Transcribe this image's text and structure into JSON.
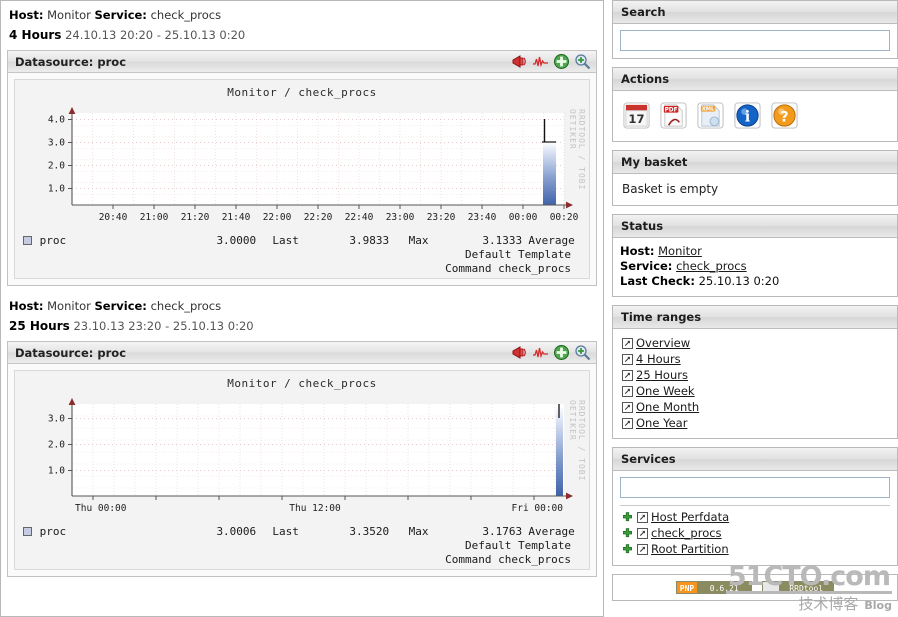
{
  "left": {
    "graphs": [
      {
        "host_label": "Host:",
        "host_value": "Monitor",
        "service_label": "Service:",
        "service_value": "check_procs",
        "range_label": "4 Hours",
        "range_value": "24.10.13 20:20 - 25.10.13 0:20",
        "panel_title": "Datasource: proc",
        "tools": [
          "alert-icon",
          "signal-icon",
          "add-icon",
          "zoom-in-icon"
        ],
        "graph_title": "Monitor / check_procs",
        "watermark": "RRDTOOL / TOBI OETIKER",
        "legend": {
          "swatch_name": "proc",
          "value": "3.0000",
          "value_label": "Last",
          "max": "3.9833",
          "max_label": "Max",
          "average": "3.1333",
          "average_label": "Average",
          "template": "Default Template",
          "command": "Command check_procs"
        },
        "chart_data": {
          "type": "area",
          "title": "Monitor / check_procs",
          "xlabel": "",
          "ylabel": "",
          "ylim": [
            0,
            4.3
          ],
          "yticks": [
            1.0,
            2.0,
            3.0,
            4.0
          ],
          "ytick_labels": [
            "1.0",
            "2.0",
            "3.0",
            "4.0"
          ],
          "xticks": [
            "20:40",
            "21:00",
            "21:20",
            "21:40",
            "22:00",
            "22:20",
            "22:40",
            "23:00",
            "23:20",
            "23:40",
            "00:00",
            "00:20"
          ],
          "grid": true,
          "series": [
            {
              "name": "proc",
              "color": "#4169b0",
              "x": [
                "20:20",
                "23:40",
                "23:58",
                "00:02",
                "00:06",
                "00:10",
                "00:14",
                "00:20"
              ],
              "values": [
                0,
                0,
                3.0,
                3.9833,
                3.0,
                3.0,
                3.0,
                3.0
              ]
            }
          ],
          "notes": "Flat zero until near right edge, then a filled blue column rising to ~3.0 with a thin spike to ~3.98"
        }
      },
      {
        "host_label": "Host:",
        "host_value": "Monitor",
        "service_label": "Service:",
        "service_value": "check_procs",
        "range_label": "25 Hours",
        "range_value": "23.10.13 23:20 - 25.10.13 0:20",
        "panel_title": "Datasource: proc",
        "tools": [
          "alert-icon",
          "signal-icon",
          "add-icon",
          "zoom-in-icon"
        ],
        "graph_title": "Monitor / check_procs",
        "watermark": "RRDTOOL / TOBI OETIKER",
        "legend": {
          "swatch_name": "proc",
          "value": "3.0006",
          "value_label": "Last",
          "max": "3.3520",
          "max_label": "Max",
          "average": "3.1763",
          "average_label": "Average",
          "template": "Default Template",
          "command": "Command check_procs"
        },
        "chart_data": {
          "type": "area",
          "title": "Monitor / check_procs",
          "xlabel": "",
          "ylabel": "",
          "ylim": [
            0,
            3.6
          ],
          "yticks": [
            1.0,
            2.0,
            3.0
          ],
          "ytick_labels": [
            "1.0",
            "2.0",
            "3.0"
          ],
          "xticks": [
            "Thu 00:00",
            "Thu 12:00",
            "Fri 00:00"
          ],
          "grid": true,
          "series": [
            {
              "name": "proc",
              "color": "#4169b0",
              "x": [
                "Thu 00:00",
                "Thu 12:00",
                "Thu 23:40",
                "Thu 23:55",
                "Fri 00:00"
              ],
              "values": [
                0,
                0,
                0,
                3.0,
                3.352
              ]
            }
          ],
          "notes": "Flat zero across the day, narrow blue column at far right reaching ~3.35"
        }
      }
    ]
  },
  "right": {
    "search": {
      "title": "Search",
      "value": "",
      "placeholder": ""
    },
    "actions": {
      "title": "Actions",
      "items": [
        {
          "name": "calendar-icon",
          "label": "17"
        },
        {
          "name": "pdf-icon",
          "label": "PDF"
        },
        {
          "name": "xml-icon",
          "label": "XML"
        },
        {
          "name": "info-icon",
          "label": "i"
        },
        {
          "name": "help-icon",
          "label": "?"
        }
      ]
    },
    "basket": {
      "title": "My basket",
      "empty_text": "Basket is empty"
    },
    "status": {
      "title": "Status",
      "host_label": "Host:",
      "host_value": "Monitor",
      "service_label": "Service:",
      "service_value": "check_procs",
      "last_check_label": "Last Check:",
      "last_check_value": "25.10.13 0:20"
    },
    "time_ranges": {
      "title": "Time ranges",
      "items": [
        "Overview",
        "4 Hours",
        "25 Hours",
        "One Week",
        "One Month",
        "One Year"
      ]
    },
    "services": {
      "title": "Services",
      "filter_value": "",
      "items": [
        "Host Perfdata",
        "check_procs",
        "Root Partition"
      ]
    },
    "footer": {
      "pnp_label": "PNP",
      "pnp_version": "0.6.21",
      "rrd_label": "",
      "rrd_name": "RRDtool"
    }
  },
  "watermark": {
    "line1": "51CTO.com",
    "line2": "技术博客",
    "blog": "Blog"
  },
  "colors": {
    "accent_blue": "#4169b0",
    "panel_header": "#e2e2e2",
    "border": "#b9b9b9",
    "link": "#1a1a1a",
    "orange": "#f7941d",
    "olive": "#8b8b60"
  }
}
